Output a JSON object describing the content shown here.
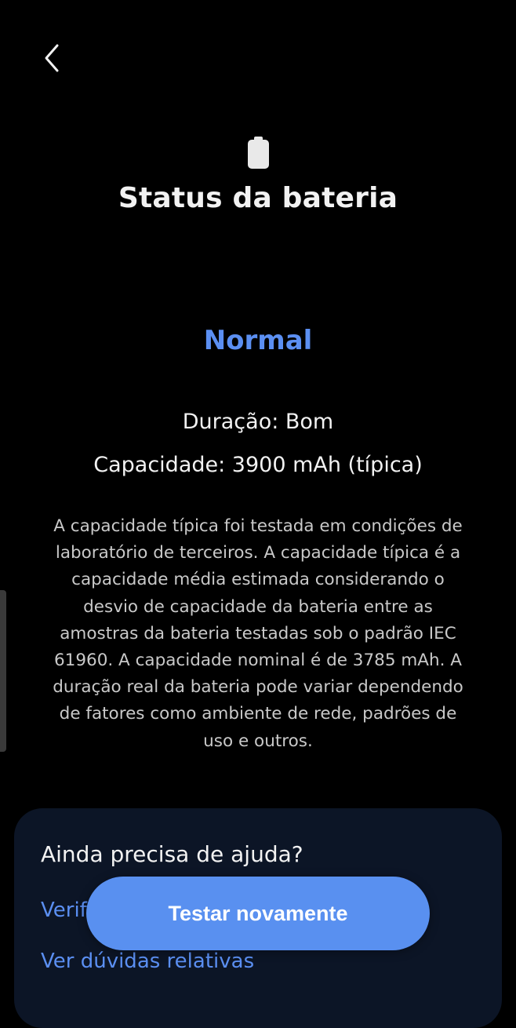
{
  "header": {
    "back_icon": "chevron-left-icon",
    "battery_icon": "battery-icon",
    "title": "Status da bateria"
  },
  "status": {
    "value": "Normal",
    "duration": "Duração: Bom",
    "capacity": "Capacidade: 3900 mAh (típica)"
  },
  "description": "A capacidade típica foi testada em condições de laboratório de terceiros. A capacidade típica é a capacidade média estimada considerando o desvio de capacidade da bateria entre as amostras da bateria testadas sob o padrão IEC 61960. A capacidade nominal é de 3785 mAh. A duração real da bateria pode variar dependendo de fatores como ambiente de rede, padrões de uso e outros.",
  "help": {
    "title": "Ainda precisa de ajuda?",
    "links": [
      {
        "label": "Verif"
      },
      {
        "label": "Ver dúvidas relativas"
      }
    ]
  },
  "actions": {
    "retest_label": "Testar novamente"
  },
  "colors": {
    "background": "#000000",
    "accent": "#5b8ff2",
    "card": "#0c1526",
    "button": "#5990f0"
  }
}
